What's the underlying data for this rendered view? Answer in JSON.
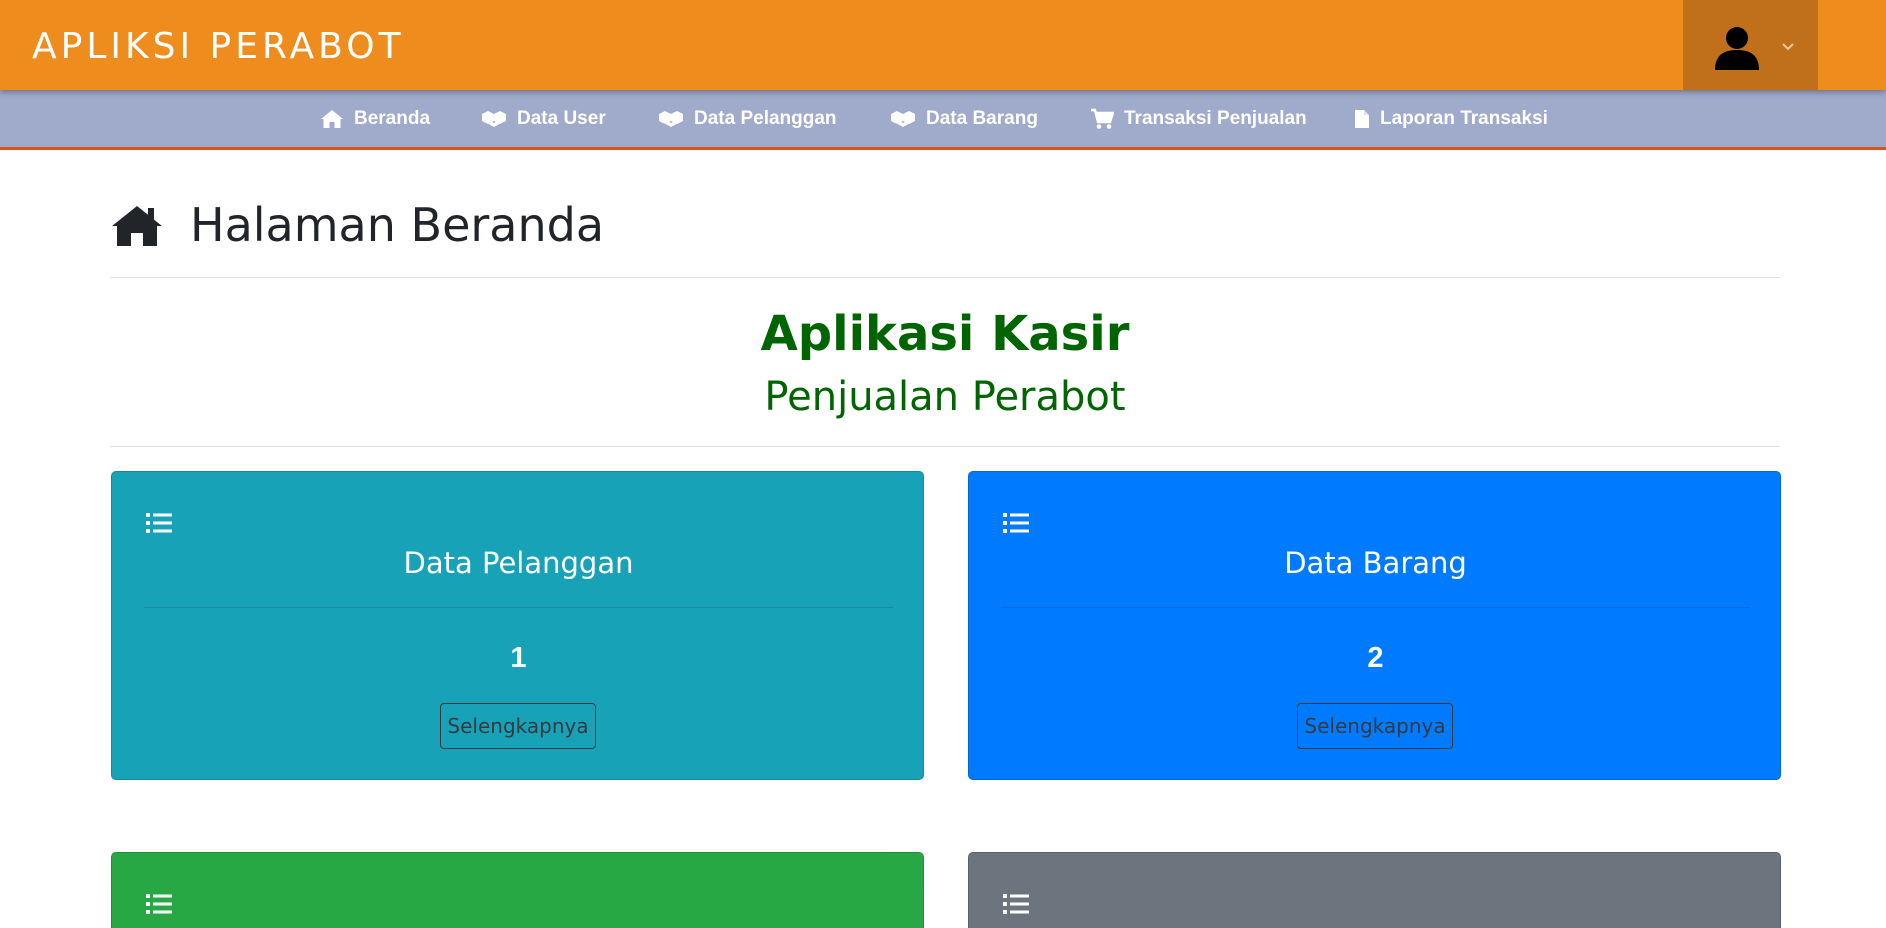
{
  "app": {
    "title": "APLIKSI PERABOT"
  },
  "nav": {
    "items": [
      {
        "label": "Beranda",
        "icon": "home-icon"
      },
      {
        "label": "Data User",
        "icon": "cubes-icon"
      },
      {
        "label": "Data Pelanggan",
        "icon": "cubes-icon"
      },
      {
        "label": "Data Barang",
        "icon": "cubes-icon"
      },
      {
        "label": "Transaksi Penjualan",
        "icon": "cart-icon"
      },
      {
        "label": "Laporan Transaksi",
        "icon": "file-icon"
      }
    ]
  },
  "page": {
    "title": "Halaman Beranda"
  },
  "hero": {
    "title": "Aplikasi Kasir",
    "subtitle": "Penjualan Perabot"
  },
  "cards": [
    {
      "title": "Data Pelanggan",
      "count": "1",
      "button": "Selengkapnya",
      "color": "#17a2b8"
    },
    {
      "title": "Data Barang",
      "count": "2",
      "button": "Selengkapnya",
      "color": "#007bff"
    },
    {
      "color": "#28a745"
    },
    {
      "color": "#6c757d"
    }
  ],
  "colors": {
    "header": "#ee8c1e",
    "navbar": "#a0aacb",
    "nav_border": "#d9531e",
    "hero_text": "#006400"
  }
}
